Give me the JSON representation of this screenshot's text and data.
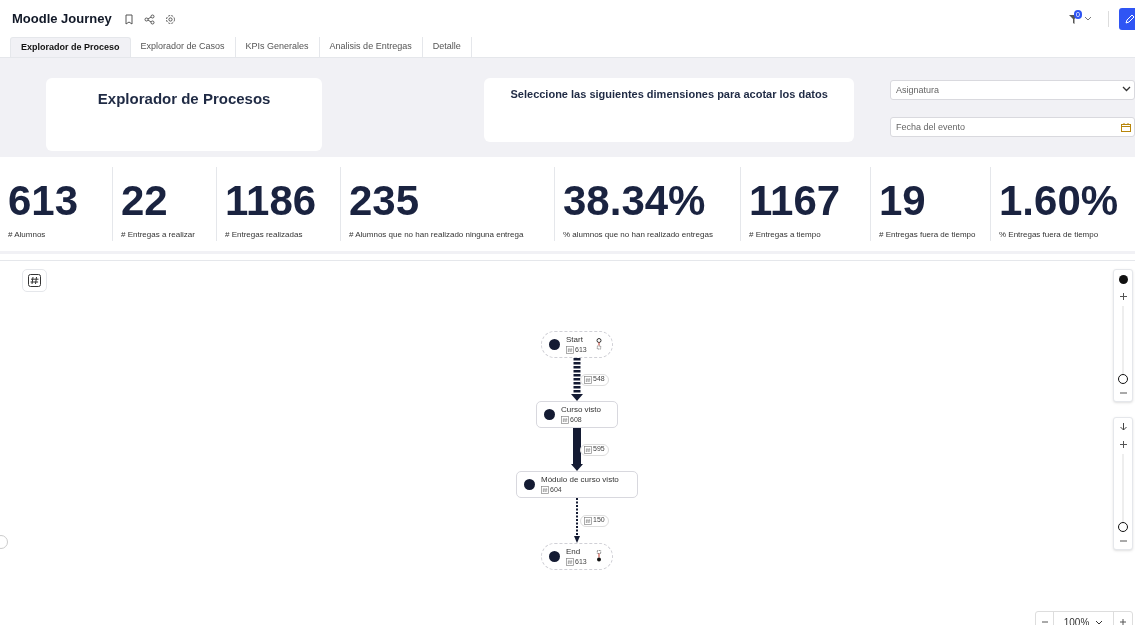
{
  "header": {
    "title": "Moodle Journey",
    "filter_count": "0"
  },
  "tabs": [
    {
      "label": "Explorador de Proceso",
      "selected": true
    },
    {
      "label": "Explorador de Casos",
      "selected": false
    },
    {
      "label": "KPIs Generales",
      "selected": false
    },
    {
      "label": "Analisis de Entregas",
      "selected": false
    },
    {
      "label": "Detalle",
      "selected": false
    }
  ],
  "title_card": {
    "title": "Explorador de Procesos"
  },
  "info_card": {
    "text": "Seleccione las siguientes dimensiones para acotar los datos"
  },
  "filters": [
    {
      "kind": "select",
      "placeholder": "Asignatura"
    },
    {
      "kind": "date",
      "placeholder": "Fecha del evento"
    }
  ],
  "kpis": [
    {
      "value": "613",
      "label": "# Alumnos"
    },
    {
      "value": "22",
      "label": "# Entregas a realizar"
    },
    {
      "value": "1186",
      "label": "# Entregas realizadas"
    },
    {
      "value": "235",
      "label": "# Alumnos que no han realizado ninguna entrega"
    },
    {
      "value": "38.34%",
      "label": "% alumnos que no han realizado entregas"
    },
    {
      "value": "1167",
      "label": "# Entregas a tiempo"
    },
    {
      "value": "19",
      "label": "# Entregas fuera de tiempo"
    },
    {
      "value": "1.60%",
      "label": "% Entregas fuera de tiempo"
    }
  ],
  "process_map": {
    "nodes": [
      {
        "kind": "start",
        "label": "Start",
        "count": "613"
      },
      {
        "kind": "activity",
        "label": "Curso visto",
        "count": "608"
      },
      {
        "kind": "activity",
        "label": "Módulo de curso visto",
        "count": "604"
      },
      {
        "kind": "end",
        "label": "End",
        "count": "613"
      }
    ],
    "edges": [
      {
        "kind": "dashed",
        "count": "548"
      },
      {
        "kind": "solid",
        "count": "595"
      },
      {
        "kind": "dotted",
        "count": "150"
      }
    ]
  },
  "sliders": [
    {
      "level": 0
    },
    {
      "level": 0
    }
  ],
  "zoom": {
    "value": "100%"
  }
}
